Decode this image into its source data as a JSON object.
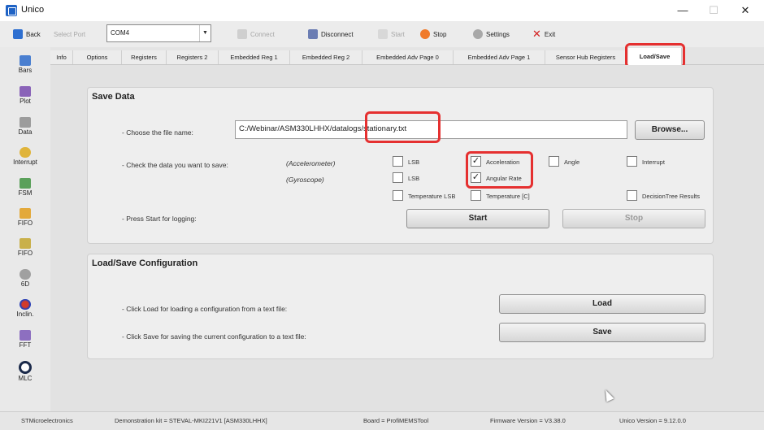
{
  "window": {
    "title": "Unico",
    "min_label": "—",
    "max_label": "☐",
    "close_label": "✕"
  },
  "toolbar": {
    "back": "Back",
    "select_port": "Select Port",
    "port_value": "COM4",
    "connect": "Connect",
    "disconnect": "Disconnect",
    "start": "Start",
    "stop": "Stop",
    "settings": "Settings",
    "exit": "Exit"
  },
  "sidebar": {
    "items": [
      {
        "label": "Bars",
        "icon": "bars-icon",
        "color": "#4a7fd0"
      },
      {
        "label": "Plot",
        "icon": "plot-icon",
        "color": "#8a63b8"
      },
      {
        "label": "Data",
        "icon": "data-icon",
        "color": "#9c9c9c"
      },
      {
        "label": "Interrupt",
        "icon": "interrupt-icon",
        "color": "#e0b43a"
      },
      {
        "label": "FSM",
        "icon": "fsm-icon",
        "color": "#5aa05a"
      },
      {
        "label": "FIFO",
        "icon": "fifo-icon",
        "color": "#e3a93b"
      },
      {
        "label": "FIFO",
        "icon": "fifo-icon",
        "color": "#c9b04a"
      },
      {
        "label": "6D",
        "icon": "6d-icon",
        "color": "#a0a0a0"
      },
      {
        "label": "Inclin.",
        "icon": "inclination-icon",
        "color": "#d23a2a"
      },
      {
        "label": "FFT",
        "icon": "fft-icon",
        "color": "#8d6fc0"
      },
      {
        "label": "MLC",
        "icon": "mlc-icon",
        "color": "#1b2a4a"
      }
    ]
  },
  "tabs": [
    "Info",
    "Options",
    "Registers",
    "Registers 2",
    "Embedded Reg 1",
    "Embedded Reg 2",
    "Embedded Adv Page 0",
    "Embedded Adv Page 1",
    "Sensor Hub Registers",
    "Load/Save"
  ],
  "save_data": {
    "title": "Save Data",
    "choose_label": "- Choose the file name:",
    "file_path": "C:/Webinar/ASM330LHHX/datalogs/stationary.txt",
    "browse": "Browse...",
    "check_label": "- Check the data you want to save:",
    "accel_label": "(Accelerometer)",
    "gyro_label": "(Gyroscope)",
    "accel_lsb": "LSB",
    "acceleration": "Acceleration",
    "angle": "Angle",
    "interrupt": "Interrupt",
    "gyro_lsb": "LSB",
    "angular_rate": "Angular Rate",
    "temp_lsb": "Temperature LSB",
    "temp_c": "Temperature [C]",
    "decision_tree": "DecisionTree Results",
    "press_label": "- Press Start for logging:",
    "start": "Start",
    "stop": "Stop"
  },
  "config": {
    "title": "Load/Save Configuration",
    "load_text": "- Click Load for loading a configuration from a text file:",
    "save_text": "- Click Save for saving the current configuration to a text file:",
    "load": "Load",
    "save": "Save"
  },
  "status": {
    "vendor": "STMicroelectronics",
    "kit": "Demonstration kit = STEVAL-MKI221V1 [ASM330LHHX]",
    "board": "Board = ProfiMEMSTool",
    "firmware": "Firmware Version = V3.38.0",
    "unico": "Unico Version = 9.12.0.0"
  },
  "colors": {
    "highlight": "#e53030",
    "back_arrow": "#2e6fd0",
    "stop_icon": "#f07a2a",
    "exit_icon": "#d32020"
  }
}
